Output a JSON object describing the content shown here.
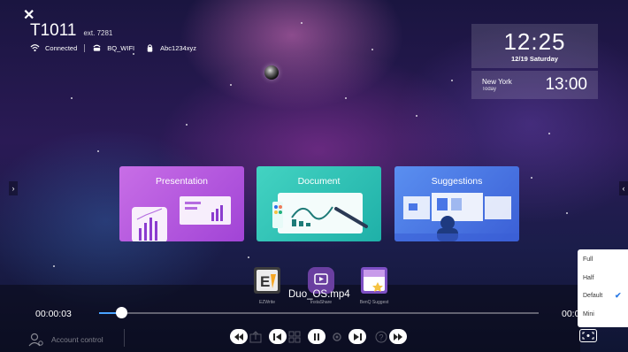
{
  "header": {
    "close_label": "✕",
    "room_name": "T1011",
    "extension": "ext. 7281",
    "network_status": "Connected",
    "wifi_name": "BQ_WIFI",
    "wifi_password": "Abc1234xyz"
  },
  "clock": {
    "time": "12:25",
    "date": "12/19 Saturday",
    "world_city": "New York",
    "world_day": "Today",
    "world_time": "13:00"
  },
  "cards": [
    {
      "label": "Presentation",
      "color": "#b25ae0"
    },
    {
      "label": "Document",
      "color": "#2ec4b6"
    },
    {
      "label": "Suggestions",
      "color": "#4a76e6"
    }
  ],
  "dock": [
    {
      "label": "EZWrite",
      "icon": "ezwrite-icon"
    },
    {
      "label": "InstaShare",
      "icon": "instashare-icon"
    },
    {
      "label": "BenQ Suggest",
      "icon": "suggest-icon"
    }
  ],
  "player": {
    "filename": "Duo_OS.mp4",
    "current_time": "00:00:03",
    "end_time": "00:0",
    "progress": 0.05,
    "accent": "#4aa3ff"
  },
  "account": {
    "label": "Account control"
  },
  "size_menu": {
    "items": [
      "Full",
      "Half",
      "Default",
      "Mini"
    ],
    "selected": "Default"
  }
}
